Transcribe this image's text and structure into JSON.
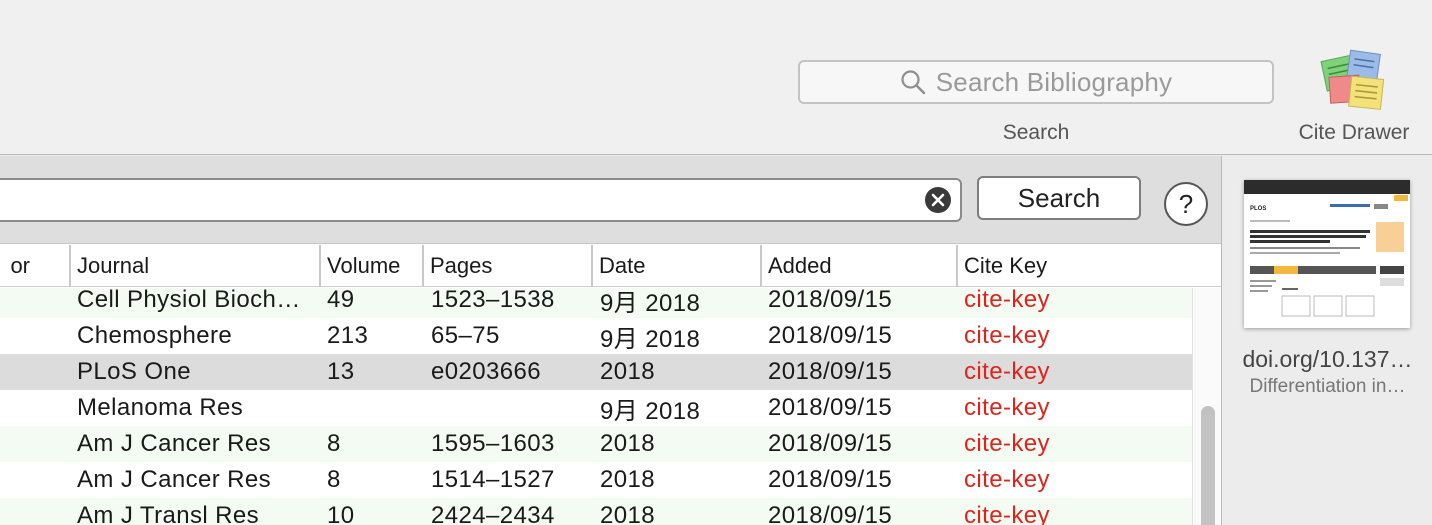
{
  "toolbar": {
    "search_placeholder": "Search Bibliography",
    "search_label": "Search",
    "cite_drawer_label": "Cite Drawer"
  },
  "search_bar": {
    "query_value": "",
    "search_button_label": "Search",
    "help_label": "?"
  },
  "table": {
    "columns": {
      "author": "or",
      "journal": "Journal",
      "volume": "Volume",
      "pages": "Pages",
      "date": "Date",
      "added": "Added",
      "citekey": "Cite Key"
    },
    "rows": [
      {
        "journal": "Cell Physiol Bioch…",
        "volume": "49",
        "pages": "1523–1538",
        "date": "9月 2018",
        "added": "2018/09/15",
        "citekey": "cite-key"
      },
      {
        "journal": "Chemosphere",
        "volume": "213",
        "pages": "65–75",
        "date": "9月 2018",
        "added": "2018/09/15",
        "citekey": "cite-key"
      },
      {
        "journal": "PLoS One",
        "volume": "13",
        "pages": "e0203666",
        "date": "2018",
        "added": "2018/09/15",
        "citekey": "cite-key"
      },
      {
        "journal": "Melanoma Res",
        "volume": "",
        "pages": "",
        "date": "9月 2018",
        "added": "2018/09/15",
        "citekey": "cite-key"
      },
      {
        "journal": "Am J Cancer Res",
        "volume": "8",
        "pages": "1595–1603",
        "date": "2018",
        "added": "2018/09/15",
        "citekey": "cite-key"
      },
      {
        "journal": "Am J Cancer Res",
        "volume": "8",
        "pages": "1514–1527",
        "date": "2018",
        "added": "2018/09/15",
        "citekey": "cite-key"
      },
      {
        "journal": "Am J Transl Res",
        "volume": "10",
        "pages": "2424–2434",
        "date": "2018",
        "added": "2018/09/15",
        "citekey": "cite-key"
      }
    ]
  },
  "side_panel": {
    "title": "doi.org/10.137…",
    "subtitle": "Differentiation in…"
  },
  "colors": {
    "citekey": "#e0241b",
    "alt_row": "#f3fbf2",
    "selected_row": "#dcdcdc"
  }
}
